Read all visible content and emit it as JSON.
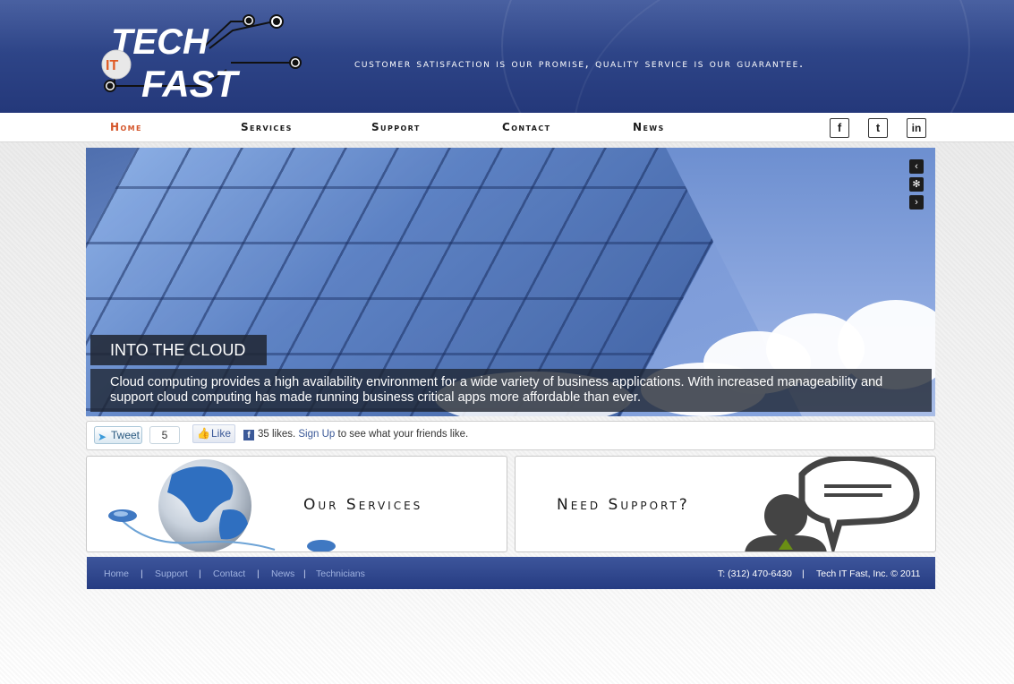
{
  "header": {
    "logo": {
      "text_top": "TECH",
      "text_mid": "IT",
      "text_bottom": "FAST"
    },
    "tagline": "Customer satisfaction is our promise, Quality service is our guarantee."
  },
  "nav": {
    "items": [
      {
        "label": "Home",
        "active": true
      },
      {
        "label": "Services",
        "active": false
      },
      {
        "label": "Support",
        "active": false
      },
      {
        "label": "Contact",
        "active": false
      },
      {
        "label": "News",
        "active": false
      }
    ],
    "social": [
      {
        "name": "facebook-icon",
        "glyph": "f"
      },
      {
        "name": "twitter-icon",
        "glyph": "t"
      },
      {
        "name": "linkedin-icon",
        "glyph": "in"
      }
    ]
  },
  "slider": {
    "title": "INTO THE CLOUD",
    "caption": "Cloud computing provides a high availability environment for a wide variety of business applications. With increased manageability and support cloud computing has made running business critical apps more affordable than ever.",
    "controls": {
      "prev": "‹",
      "pause": "✻",
      "next": "›"
    }
  },
  "social_bar": {
    "tweet_label": "Tweet",
    "tweet_count": "5",
    "like_label": "Like",
    "like_count_text": "35 likes.",
    "signup_label": "Sign Up",
    "like_suffix": "to see what your friends like."
  },
  "panels": {
    "services_title": "Our Services",
    "support_title": "Need Support?"
  },
  "footer": {
    "links": [
      "Home",
      "Support",
      "Contact",
      "News",
      "Technicians"
    ],
    "phone": "T: (312) 470-6430",
    "copyright": "Tech IT Fast, Inc. © 2011"
  },
  "colors": {
    "header_blue": "#2e4588",
    "accent_orange": "#d4552a",
    "footer_blue": "#2f4690"
  }
}
